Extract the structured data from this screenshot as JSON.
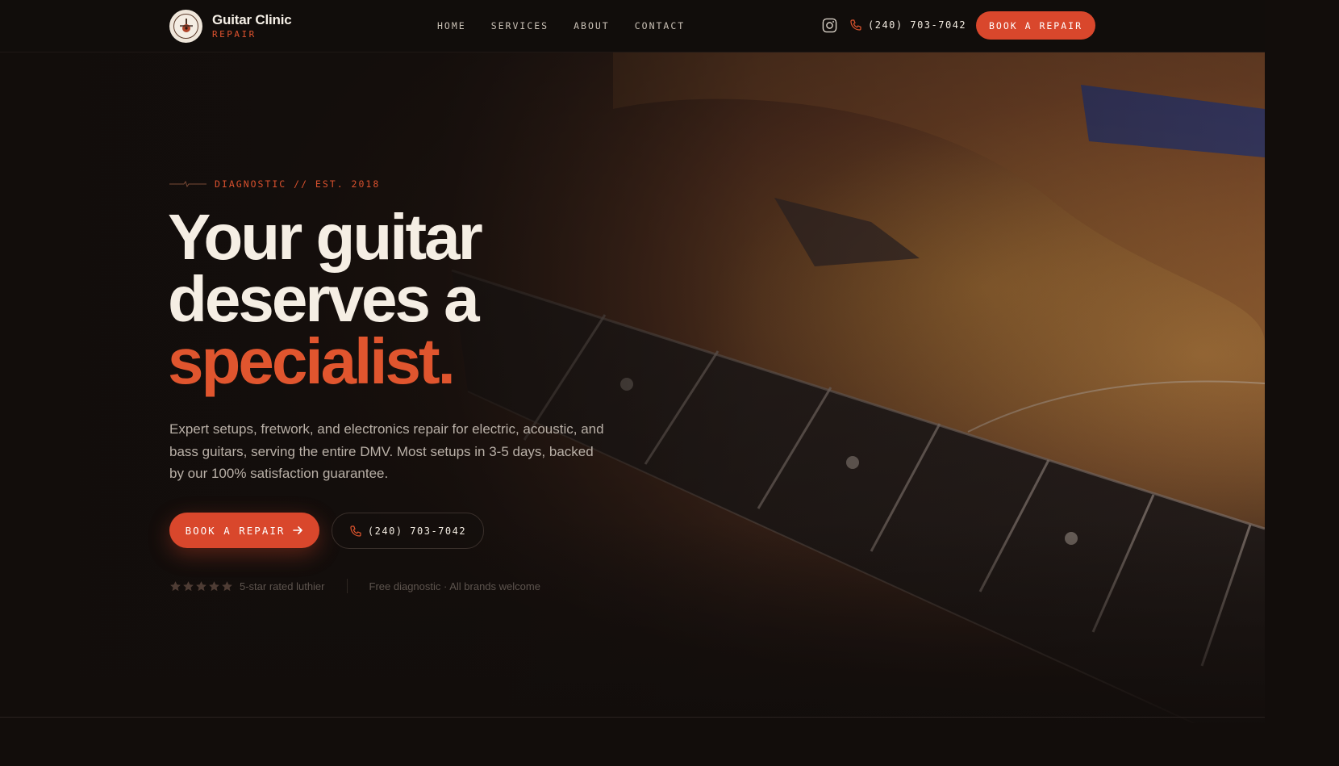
{
  "brand": {
    "name": "Guitar Clinic",
    "tagline": "REPAIR",
    "logo_text": "GUITAR CLINIC"
  },
  "nav": {
    "items": [
      {
        "label": "HOME"
      },
      {
        "label": "SERVICES"
      },
      {
        "label": "ABOUT"
      },
      {
        "label": "CONTACT"
      }
    ]
  },
  "header": {
    "social_icon": "instagram-icon",
    "phone_icon": "phone-icon",
    "phone": "(240) 703-7042",
    "cta_label": "BOOK A REPAIR"
  },
  "hero": {
    "eyebrow": "DIAGNOSTIC // EST. 2018",
    "headline_line1": "Your guitar",
    "headline_line2": "deserves a",
    "headline_accent": "specialist.",
    "lead": "Expert setups, fretwork, and electronics repair for electric, acoustic, and bass guitars, serving the entire DMV. Most setups in 3-5 days, backed by our 100% satisfaction guarantee.",
    "primary_cta": "BOOK A REPAIR",
    "primary_cta_icon": "arrow-right-icon",
    "secondary_cta": "(240) 703-7042",
    "rating_stars": 5,
    "rating_text": "5-star rated luthier",
    "note": "Free diagnostic · All brands welcome"
  },
  "colors": {
    "accent": "#d9472c",
    "accent_text": "#e0552e",
    "background": "#120d0b",
    "headline": "#f5eee4",
    "body_text": "#b9b0a7",
    "muted": "#5d544e"
  }
}
